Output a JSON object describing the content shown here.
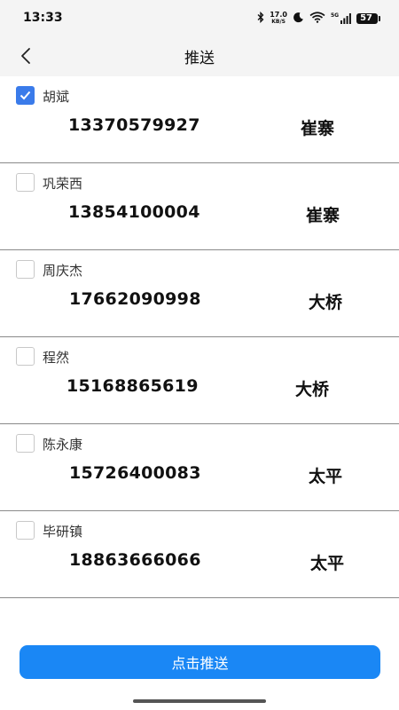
{
  "status_bar": {
    "time": "13:33",
    "net_speed_value": "17.0",
    "net_speed_unit": "KB/S",
    "network_label": "5G",
    "battery": "57",
    "icons": [
      "bluetooth-icon",
      "moon-icon",
      "wifi-icon",
      "signal-icon",
      "battery-icon"
    ]
  },
  "header": {
    "title": "推送",
    "back_icon": "chevron-left-icon"
  },
  "list": {
    "items": [
      {
        "name": "胡斌",
        "phone": "13370579927",
        "place": "崔寨",
        "checked": true
      },
      {
        "name": "巩荣西",
        "phone": "13854100004",
        "place": "崔寨",
        "checked": false
      },
      {
        "name": "周庆杰",
        "phone": "17662090998",
        "place": "大桥",
        "checked": false
      },
      {
        "name": "程然",
        "phone": "15168865619",
        "place": "大桥",
        "checked": false
      },
      {
        "name": "陈永康",
        "phone": "15726400083",
        "place": "太平",
        "checked": false
      },
      {
        "name": "毕研镇",
        "phone": "18863666066",
        "place": "太平",
        "checked": false
      }
    ]
  },
  "footer": {
    "push_button_label": "点击推送"
  },
  "colors": {
    "accent": "#1a87f5",
    "checkbox_checked": "#3a7bea",
    "bar_background": "#f4f4f4"
  }
}
